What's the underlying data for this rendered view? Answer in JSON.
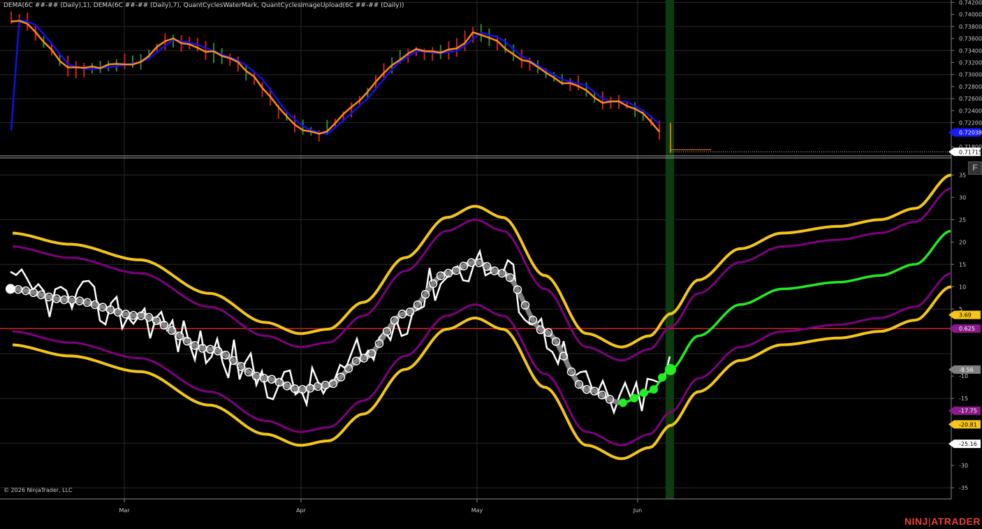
{
  "indicator_label": "DEMA(6C ##-## (Daily),1), DEMA(6C ##-## (Daily),7), QuantCyclesWaterMark, QuantCyclesImageUpload(6C ##-## (Daily))",
  "copyright": "© 2026 NinjaTrader, LLC",
  "f_button": "F",
  "brand": {
    "left": "NINJ",
    "sep": "|",
    "right": "ATRADER"
  },
  "upper_axis": {
    "labels": [
      "0.74200",
      "0.74000",
      "0.73800",
      "0.73600",
      "0.73400",
      "0.73200",
      "0.73000",
      "0.72800",
      "0.72600",
      "0.72400",
      "0.72200",
      "0.71800"
    ],
    "min": 0.7166,
    "max": 0.7424,
    "markers": [
      {
        "text": "0.72038",
        "value": 0.72038,
        "bg": "#1a1aff",
        "fg": "#ffffff"
      },
      {
        "text": "0.71715",
        "value": 0.71715,
        "bg": "#ffffff",
        "fg": "#000000"
      }
    ]
  },
  "lower_axis": {
    "labels": [
      "35",
      "30",
      "25",
      "20",
      "15",
      "10",
      "5",
      "-10",
      "-15",
      "-30",
      "-35"
    ],
    "values": [
      35,
      30,
      25,
      20,
      15,
      10,
      5,
      -10,
      -15,
      -30,
      -35
    ],
    "min": -37.5,
    "max": 38.5,
    "markers": [
      {
        "text": "3.69",
        "value": 3.69,
        "bg": "#f5c518",
        "fg": "#000000"
      },
      {
        "text": "0.625",
        "value": 0.625,
        "bg": "#8b1a8b",
        "fg": "#ffffff"
      },
      {
        "text": "-8.56",
        "value": -8.56,
        "bg": "#808080",
        "fg": "#ffffff"
      },
      {
        "text": "-17.75",
        "value": -17.75,
        "bg": "#8b1a8b",
        "fg": "#ffffff"
      },
      {
        "text": "-20.81",
        "value": -20.81,
        "bg": "#f5c518",
        "fg": "#000000"
      },
      {
        "text": "-25.16",
        "value": -25.16,
        "bg": "#ffffff",
        "fg": "#000000"
      }
    ]
  },
  "time_axis": {
    "labels": [
      "Mar",
      "Apr",
      "May",
      "Jun"
    ]
  },
  "colors": {
    "background": "#000000",
    "grid": "#2a2a2a",
    "orange": "#ff8c1a",
    "blue": "#1010ee",
    "up_bar": "#2e8b2e",
    "down_bar": "#d42020",
    "yellow": "#f5c518",
    "purple": "#800080",
    "gray": "#808080",
    "green": "#22ee22",
    "red_line": "#cc2222",
    "highlight": "#0d3d0d"
  }
}
